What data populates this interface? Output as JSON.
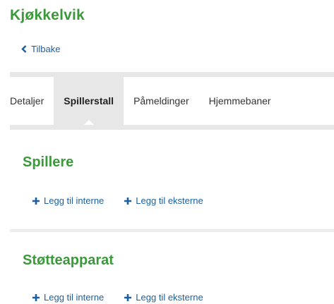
{
  "header": {
    "title": "Kjøkkelvik",
    "back_label": "Tilbake"
  },
  "tabs": [
    {
      "label": "Detaljer",
      "active": false
    },
    {
      "label": "Spillerstall",
      "active": true
    },
    {
      "label": "Påmeldinger",
      "active": false
    },
    {
      "label": "Hjemmebaner",
      "active": false
    }
  ],
  "sections": {
    "players": {
      "title": "Spillere",
      "add_internal": "Legg til interne",
      "add_external": "Legg til eksterne"
    },
    "staff": {
      "title": "Støtteapparat",
      "add_internal": "Legg til interne",
      "add_external": "Legg til eksterne"
    }
  },
  "colors": {
    "brand_green": "#3a9a3a",
    "link_blue": "#1c5f9e",
    "tab_gray": "#e7e7e7"
  },
  "icons": {
    "back": "chevron-left-icon",
    "add": "plus-icon"
  }
}
